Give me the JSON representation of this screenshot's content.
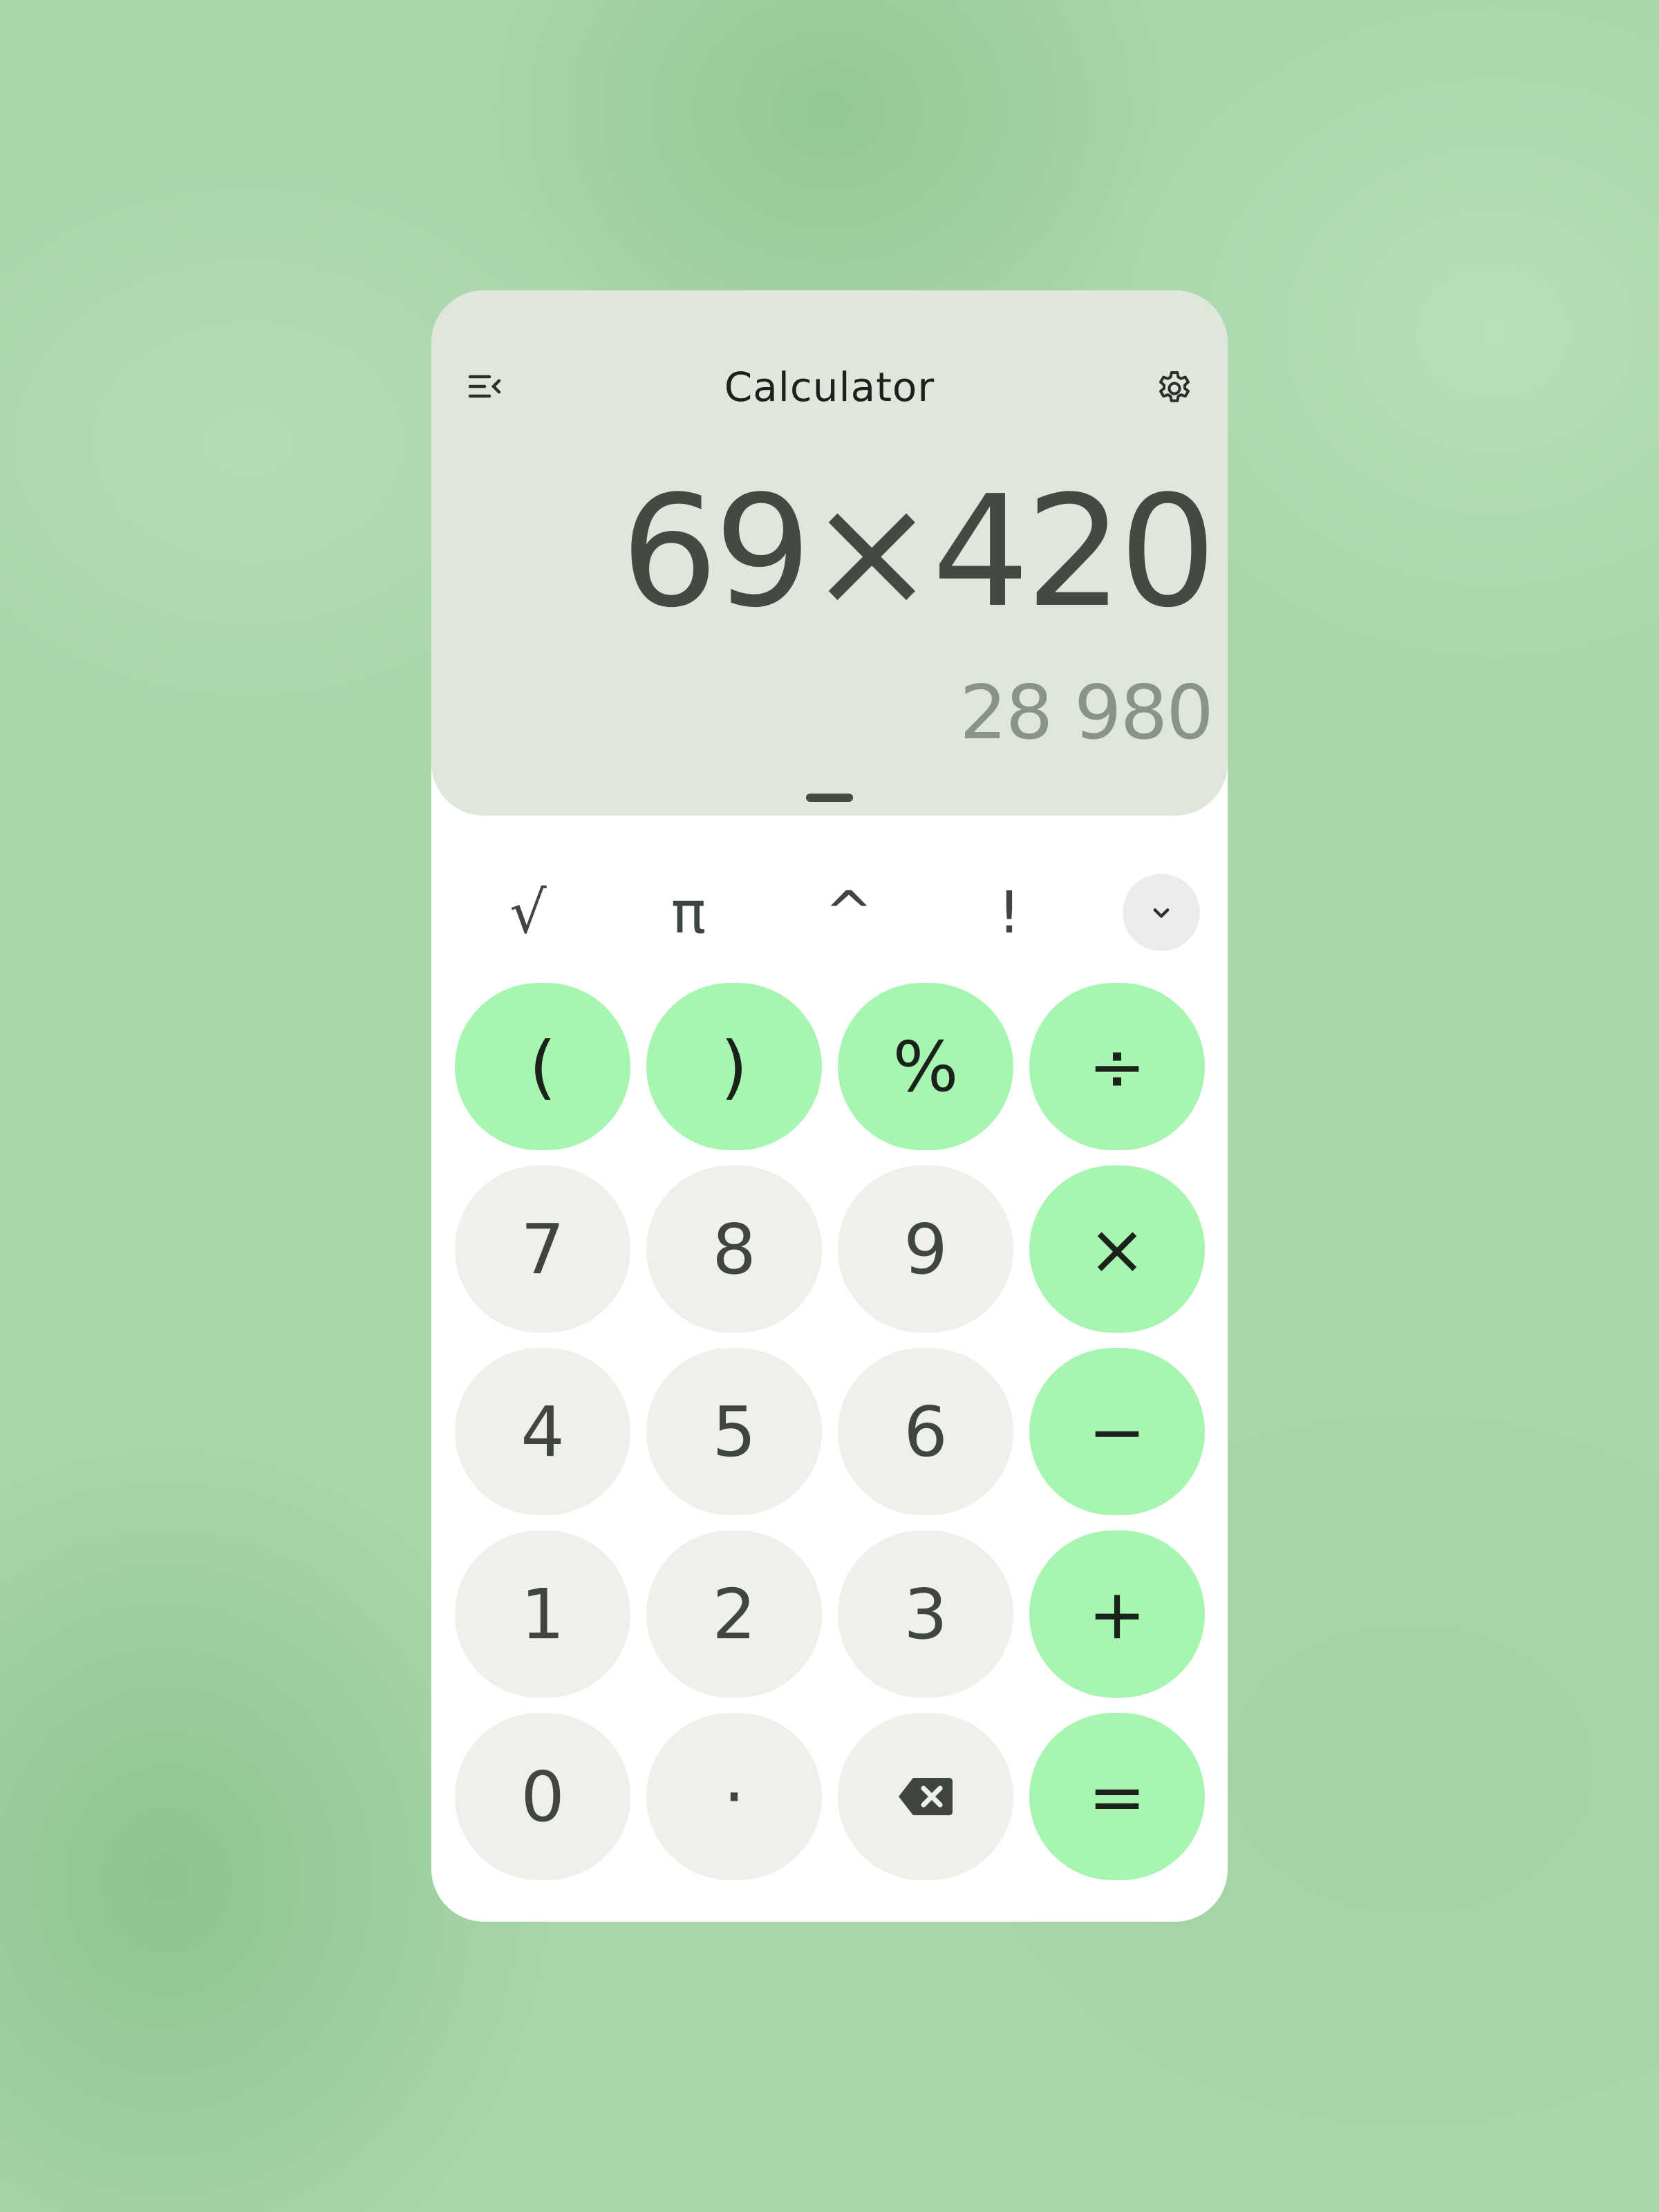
{
  "app": {
    "title": "Calculator"
  },
  "toolbar": {
    "history_icon": "history-icon",
    "settings_icon": "gear-icon"
  },
  "display": {
    "expression": "69×420",
    "result": "28 980"
  },
  "scientific": {
    "keys": [
      "√",
      "π",
      "^",
      "!"
    ],
    "expand_icon": "chevron-down-icon"
  },
  "keypad": {
    "row0": [
      "(",
      ")",
      "%",
      "÷"
    ],
    "row1": [
      "7",
      "8",
      "9",
      "×"
    ],
    "row2": [
      "4",
      "5",
      "6",
      "−"
    ],
    "row3": [
      "1",
      "2",
      "3",
      "+"
    ],
    "row4": [
      "0",
      "·",
      "backspace-icon",
      "="
    ]
  },
  "colors": {
    "display_bg": "#dfe6db",
    "number_key_bg": "#eff0ea",
    "operator_key_bg": "#a6f5b1",
    "text_dark": "#434a43",
    "text_result": "#8a938a"
  }
}
